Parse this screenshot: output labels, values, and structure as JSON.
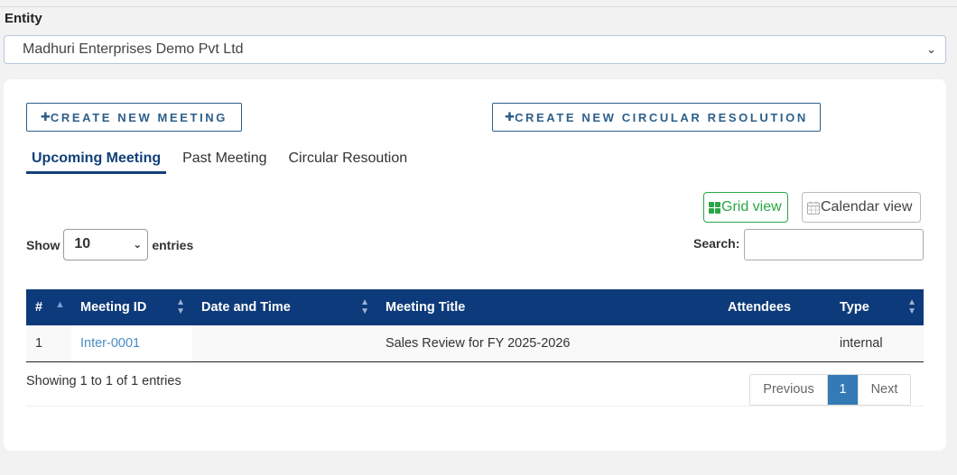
{
  "entity": {
    "label": "Entity",
    "selected": "Madhuri Enterprises Demo Pvt Ltd"
  },
  "actions": {
    "create_meeting": "CREATE NEW MEETING",
    "create_circular": "CREATE NEW CIRCULAR RESOLUTION"
  },
  "tabs": [
    {
      "label": "Upcoming Meeting",
      "active": true
    },
    {
      "label": "Past Meeting",
      "active": false
    },
    {
      "label": "Circular Resoution",
      "active": false
    }
  ],
  "views": {
    "grid": "Grid view",
    "calendar": "Calendar view"
  },
  "table_controls": {
    "show_label": "Show",
    "entries_value": "10",
    "entries_label": "entries",
    "search_label": "Search:"
  },
  "table": {
    "columns": [
      "#",
      "Meeting ID",
      "Date and Time",
      "Meeting Title",
      "Attendees",
      "Type"
    ],
    "rows": [
      {
        "num": "1",
        "meeting_id": "Inter-0001",
        "date_time": "",
        "title": "Sales Review for FY 2025-2026",
        "attendees": "",
        "type": "internal"
      }
    ]
  },
  "footer": {
    "info": "Showing 1 to 1 of 1 entries",
    "prev": "Previous",
    "page": "1",
    "next": "Next"
  },
  "colors": {
    "header_bg": "#0d3a7a",
    "accent_blue": "#2c5f8a",
    "grid_green": "#28a745",
    "page_active": "#337ab7"
  }
}
